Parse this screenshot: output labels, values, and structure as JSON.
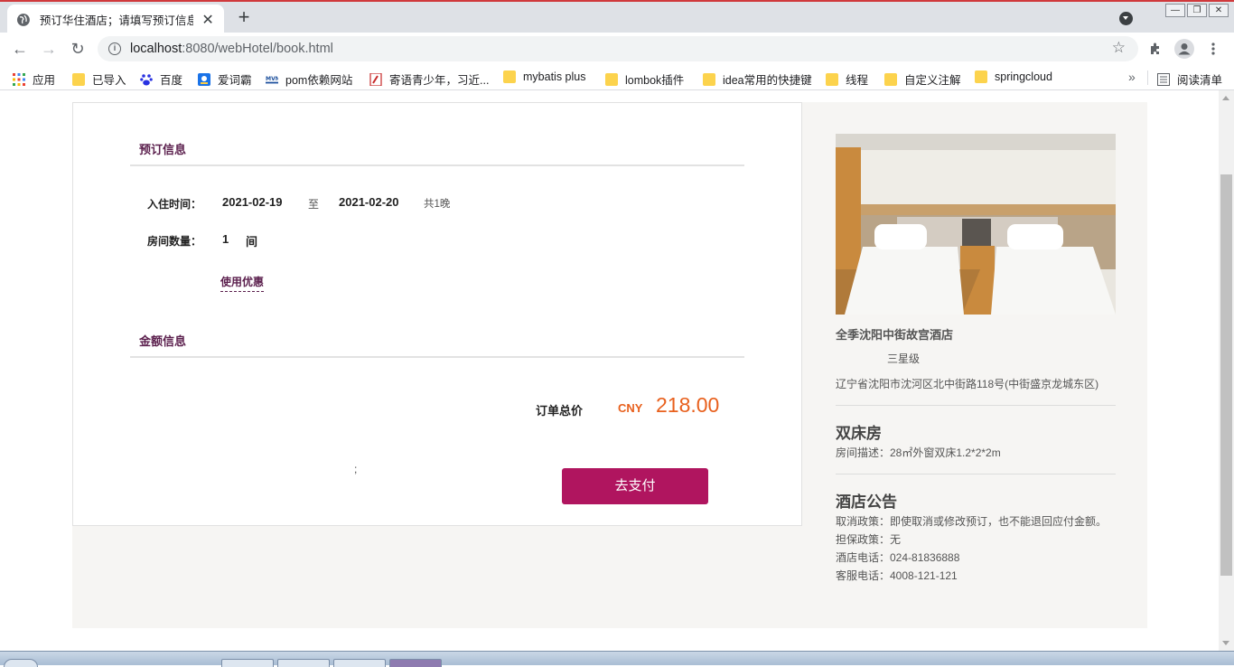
{
  "browser": {
    "tab_title": "预订华住酒店；请填写预订信息",
    "tab_close": "✕",
    "new_tab": "+",
    "url_host": "localhost",
    "url_rest": ":8080/webHotel/book.html",
    "back": "←",
    "forward": "→",
    "reload": "↻",
    "star": "☆",
    "window_controls": [
      "—",
      "❐",
      "✕"
    ]
  },
  "bookmarks": [
    {
      "label": "应用",
      "icon": "apps-grid-icon"
    },
    {
      "label": "已导入",
      "icon": "folder-icon"
    },
    {
      "label": "百度",
      "icon": "baidu-paw-icon"
    },
    {
      "label": "爱词霸",
      "icon": "iciba-icon"
    },
    {
      "label": "pom依赖网站",
      "icon": "mvn-icon"
    },
    {
      "label": "寄语青少年，习近...",
      "icon": "red-page-icon"
    },
    {
      "label": "mybatis plus",
      "icon": "folder-icon"
    },
    {
      "label": "lombok插件",
      "icon": "folder-icon"
    },
    {
      "label": "idea常用的快捷键",
      "icon": "folder-icon"
    },
    {
      "label": "线程",
      "icon": "folder-icon"
    },
    {
      "label": "自定义注解",
      "icon": "folder-icon"
    },
    {
      "label": "springcloud",
      "icon": "folder-icon"
    }
  ],
  "bookmarks_more": "»",
  "reading_list": "阅读清单",
  "booking": {
    "section_title": "预订信息",
    "checkin_label": "入住时间：",
    "checkin_date": "2021-02-19",
    "to": "至",
    "checkout_date": "2021-02-20",
    "nights": "共1晚",
    "rooms_label": "房间数量：",
    "rooms_count": "1",
    "rooms_unit": "间",
    "coupon": "使用优惠"
  },
  "amount": {
    "section_title": "金额信息",
    "total_label": "订单总价",
    "currency": "CNY",
    "total": "218.00",
    "semicolon": ";",
    "pay_button": "去支付"
  },
  "hotel": {
    "name": "全季沈阳中街故宫酒店",
    "star": "三星级",
    "address": "辽宁省沈阳市沈河区北中街路118号(中街盛京龙城东区)",
    "room_type": "双床房",
    "room_desc": "房间描述：28㎡外窗双床1.2*2*2m",
    "notice_title": "酒店公告",
    "notices": [
      "取消政策：即使取消或修改预订，也不能退回应付金额。",
      "担保政策：无",
      "酒店电话：024-81836888",
      "客服电话：4008-121-121"
    ]
  },
  "colors": {
    "accent": "#b0155f",
    "section_title": "#5b1f4d",
    "price": "#e8601d",
    "panel_bg": "#f6f5f3"
  }
}
